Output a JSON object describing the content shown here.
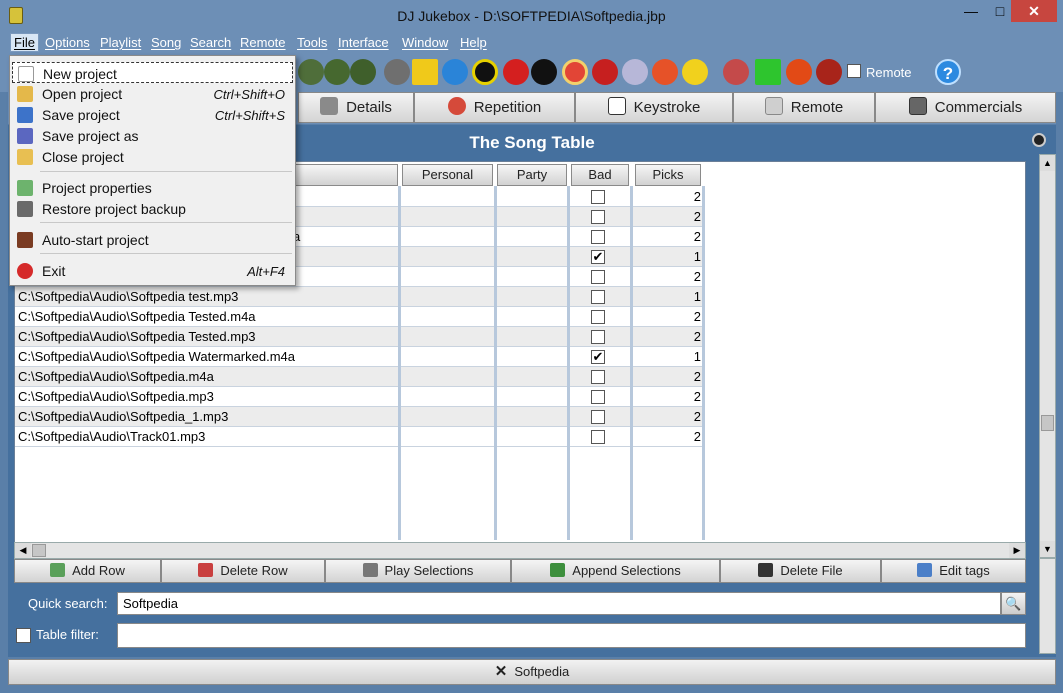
{
  "window": {
    "title": "DJ Jukebox - D:\\SOFTPEDIA\\Softpedia.jbp",
    "minimize": "—",
    "maximize": "□",
    "close": "✕"
  },
  "menu": [
    "File",
    "Options",
    "Playlist",
    "Song",
    "Search",
    "Remote",
    "Tools",
    "Interface",
    "Window",
    "Help"
  ],
  "toolbar": {
    "remote_label": "Remote",
    "help_glyph": "?"
  },
  "tabs": [
    "Details",
    "Repetition",
    "Keystroke",
    "Remote",
    "Commercials"
  ],
  "panel": {
    "title": "The Song Table"
  },
  "table": {
    "columns": [
      "Personal",
      "Party",
      "Bad",
      "Picks"
    ],
    "rows": [
      {
        "path": "",
        "bad": false,
        "picks": "2"
      },
      {
        "path": "",
        "bad": false,
        "picks": "2"
      },
      {
        "path": "",
        "bad": false,
        "picks": "2"
      },
      {
        "path": "",
        "bad": true,
        "picks": "1"
      },
      {
        "path": "",
        "bad": false,
        "picks": "2"
      },
      {
        "path": "C:\\Softpedia\\Audio\\Softpedia test.mp3",
        "bad": false,
        "picks": "1"
      },
      {
        "path": "C:\\Softpedia\\Audio\\Softpedia Tested.m4a",
        "bad": false,
        "picks": "2"
      },
      {
        "path": "C:\\Softpedia\\Audio\\Softpedia Tested.mp3",
        "bad": false,
        "picks": "2"
      },
      {
        "path": "C:\\Softpedia\\Audio\\Softpedia Watermarked.m4a",
        "bad": true,
        "picks": "1"
      },
      {
        "path": "C:\\Softpedia\\Audio\\Softpedia.m4a",
        "bad": false,
        "picks": "2"
      },
      {
        "path": "C:\\Softpedia\\Audio\\Softpedia.mp3",
        "bad": false,
        "picks": "2"
      },
      {
        "path": "C:\\Softpedia\\Audio\\Softpedia_1.mp3",
        "bad": false,
        "picks": "2"
      },
      {
        "path": "C:\\Softpedia\\Audio\\Track01.mp3",
        "bad": false,
        "picks": "2"
      }
    ],
    "partial_a": "a",
    "check_glyph": "✔"
  },
  "actions": [
    "Add Row",
    "Delete Row",
    "Play Selections",
    "Append Selections",
    "Delete File",
    "Edit tags"
  ],
  "search": {
    "label": "Quick search:",
    "value": "Softpedia",
    "button_glyph": "🔍"
  },
  "filter": {
    "label": "Table filter:",
    "value": ""
  },
  "statusbar": {
    "text": "Softpedia",
    "close_glyph": "✕"
  },
  "file_menu": [
    {
      "label": "New project",
      "shortcut": ""
    },
    {
      "label": "Open project",
      "shortcut": "Ctrl+Shift+O"
    },
    {
      "label": "Save project",
      "shortcut": "Ctrl+Shift+S"
    },
    {
      "label": "Save project as",
      "shortcut": ""
    },
    {
      "label": "Close project",
      "shortcut": ""
    },
    {
      "label": "Project properties",
      "shortcut": ""
    },
    {
      "label": "Restore project backup",
      "shortcut": ""
    },
    {
      "label": "Auto-start project",
      "shortcut": ""
    },
    {
      "label": "Exit",
      "shortcut": "Alt+F4"
    }
  ],
  "colors": {
    "window": "#6d8fb6",
    "panel": "#45709e",
    "selected_menu": "#d8e6f5",
    "close_red": "#c7463f"
  }
}
